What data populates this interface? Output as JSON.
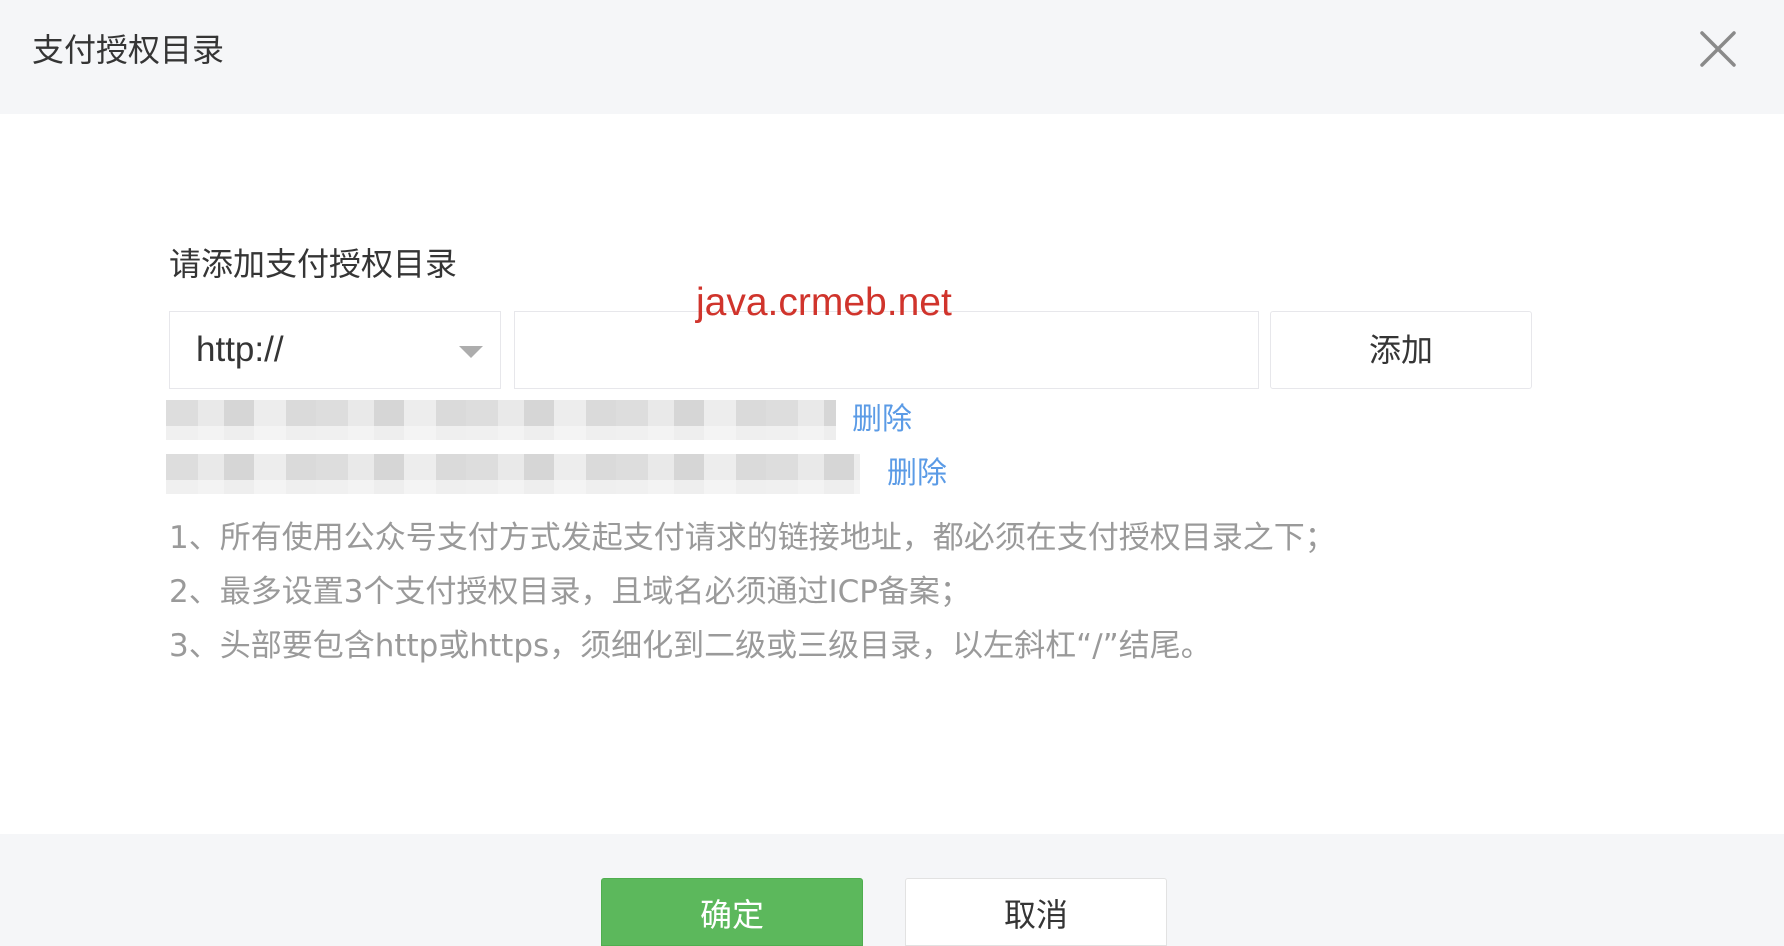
{
  "dialog": {
    "title": "支付授权目录",
    "close_icon": "close-icon"
  },
  "form": {
    "label": "请添加支付授权目录",
    "protocol": {
      "selected": "http://",
      "icon": "chevron-down-icon"
    },
    "path_input": {
      "value": "",
      "placeholder": ""
    },
    "add_label": "添加"
  },
  "watermark": "java.crmeb.net",
  "directories": [
    {
      "value": "",
      "delete_label": "删除"
    },
    {
      "value": "",
      "delete_label": "删除"
    }
  ],
  "notes": [
    "1、所有使用公众号支付方式发起支付请求的链接地址，都必须在支付授权目录之下；",
    "2、最多设置3个支付授权目录，且域名必须通过ICP备案；",
    "3、头部要包含http或https，须细化到二级或三级目录，以左斜杠“/”结尾。"
  ],
  "footer": {
    "confirm_label": "确定",
    "cancel_label": "取消"
  },
  "colors": {
    "header_bg": "#f5f6f8",
    "primary_green": "#5cb85c",
    "link_blue": "#5b9be6",
    "watermark_red": "#d0342c",
    "note_gray": "#9a9a9a"
  }
}
